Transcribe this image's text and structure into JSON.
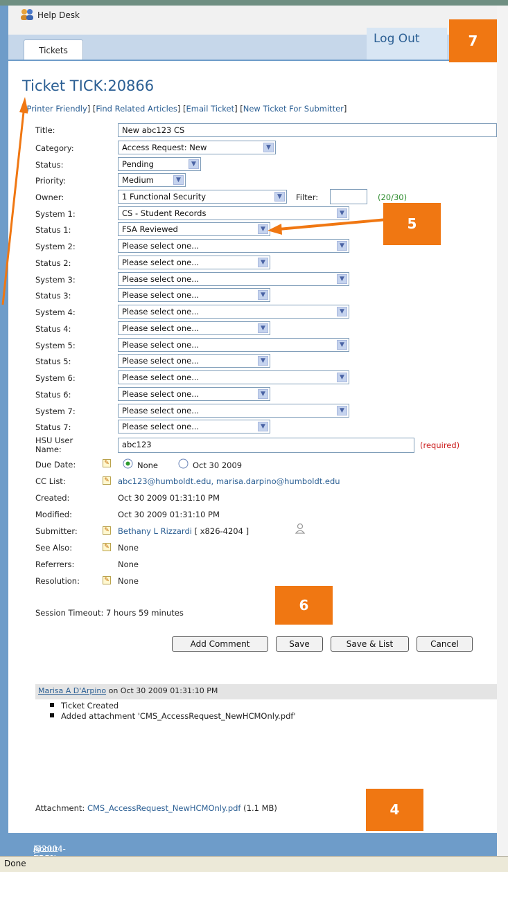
{
  "app": {
    "title": "Help Desk",
    "tab": "Tickets",
    "logout": "Log Out"
  },
  "annotations": {
    "b4": "4",
    "b5": "5",
    "b6": "6",
    "b7": "7"
  },
  "ticket": {
    "heading": "Ticket TICK:20866",
    "links": [
      "Printer Friendly",
      "Find Related Articles",
      "Email Ticket",
      "New Ticket For Submitter"
    ],
    "labels": {
      "title": "Title:",
      "category": "Category:",
      "status": "Status:",
      "priority": "Priority:",
      "owner": "Owner:",
      "filter": "Filter:",
      "hsu": "HSU User Name:",
      "due": "Due Date:",
      "cc": "CC List:",
      "created": "Created:",
      "modified": "Modified:",
      "submitter": "Submitter:",
      "see_also": "See Also:",
      "referrers": "Referrers:",
      "resolution": "Resolution:"
    },
    "values": {
      "title": "New abc123 CS",
      "category": "Access Request: New",
      "status": "Pending",
      "priority": "Medium",
      "owner": "1 Functional Security",
      "filter_count": "(20/30)",
      "hsu": "abc123",
      "required": "(required)",
      "due_none": "None",
      "due_date": "Oct 30 2009",
      "cc": "abc123@humboldt.edu, marisa.darpino@humboldt.edu",
      "created": "Oct 30 2009 01:31:10 PM",
      "modified": "Oct 30 2009 01:31:10 PM",
      "submitter": "Bethany L Rizzardi",
      "submitter_ext": "[ x826-4204 ]",
      "see_also": "None",
      "referrers": "None",
      "resolution": "None"
    },
    "systems": [
      {
        "system_label": "System 1:",
        "system_value": "CS - Student Records",
        "status_label": "Status 1:",
        "status_value": "FSA Reviewed"
      },
      {
        "system_label": "System 2:",
        "system_value": "Please select one...",
        "status_label": "Status 2:",
        "status_value": "Please select one..."
      },
      {
        "system_label": "System 3:",
        "system_value": "Please select one...",
        "status_label": "Status 3:",
        "status_value": "Please select one..."
      },
      {
        "system_label": "System 4:",
        "system_value": "Please select one...",
        "status_label": "Status 4:",
        "status_value": "Please select one..."
      },
      {
        "system_label": "System 5:",
        "system_value": "Please select one...",
        "status_label": "Status 5:",
        "status_value": "Please select one..."
      },
      {
        "system_label": "System 6:",
        "system_value": "Please select one...",
        "status_label": "Status 6:",
        "status_value": "Please select one..."
      },
      {
        "system_label": "System 7:",
        "system_value": "Please select one...",
        "status_label": "Status 7:",
        "status_value": "Please select one..."
      }
    ],
    "session": "Session Timeout: 7 hours 59 minutes",
    "buttons": {
      "add_comment": "Add Comment",
      "save": "Save",
      "save_list": "Save & List",
      "cancel": "Cancel"
    },
    "comment": {
      "author": "Marisa A D'Arpino",
      "meta": "on Oct 30 2009 01:31:10 PM",
      "items": [
        "Ticket Created",
        "Added attachment 'CMS_AccessRequest_NewHCMOnly.pdf'"
      ]
    },
    "attachment": {
      "label": "Attachment:",
      "file": "CMS_AccessRequest_NewHCMOnly.pdf",
      "size": "(1.1 MB)"
    }
  },
  "footer": {
    "about": "About KBOX",
    "sep": "|",
    "copyright": "@2004-2009 KACE Networks, Inc. All Rights Reserved."
  },
  "statusbar": {
    "text": "Done"
  },
  "colors": {
    "accent": "#2a5e93",
    "annotation": "#f07712",
    "required": "#cc2222",
    "count": "#2a8a2a"
  }
}
